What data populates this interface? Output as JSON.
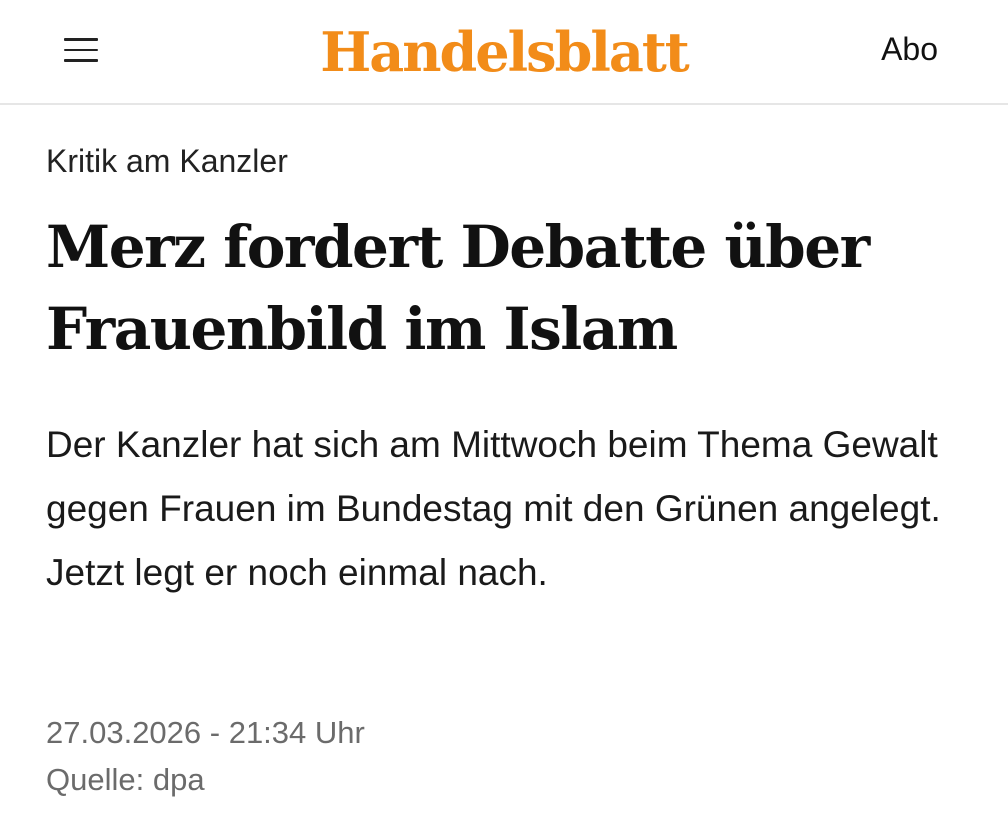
{
  "header": {
    "menu_icon": "hamburger-menu-icon",
    "logo_text": "Handelsblatt",
    "abo_label": "Abo",
    "brand_color": "#f28c19"
  },
  "article": {
    "kicker": "Kritik am Kanzler",
    "headline": "Merz fordert Debatte über Frauenbild im Islam",
    "lead": "Der Kanzler hat sich am Mittwoch beim Thema Gewalt gegen Frauen im Bundestag mit den Grünen angelegt. Jetzt legt er noch einmal nach.",
    "dateline": "27.03.2026 - 21:34 Uhr",
    "source": "Quelle: dpa"
  }
}
